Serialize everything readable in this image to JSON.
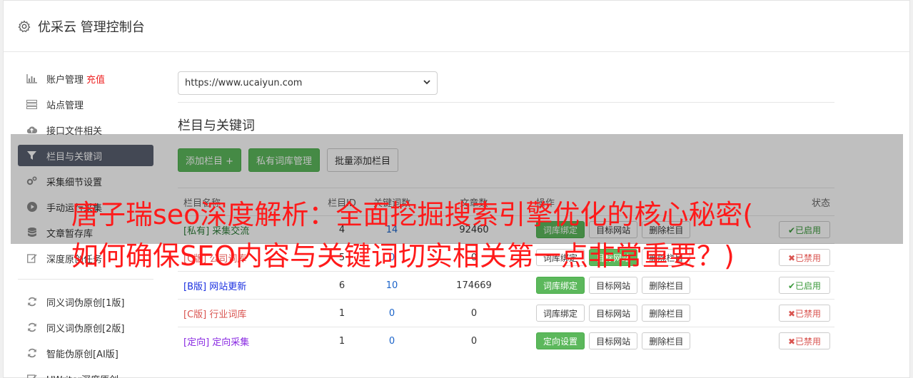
{
  "header": {
    "title": "优采云 管理控制台"
  },
  "sidebar": {
    "items": [
      {
        "label": "账户管理",
        "extra": "充值",
        "icon": "bar-chart-icon"
      },
      {
        "label": "站点管理",
        "icon": "server-icon"
      },
      {
        "label": "接口文件相关",
        "icon": "cloud-upload-icon"
      },
      {
        "label": "栏目与关键词",
        "icon": "filter-icon",
        "active": true
      },
      {
        "label": "采集细节设置",
        "icon": "cogs-icon"
      },
      {
        "label": "手动运行采集",
        "icon": "play-circle-icon"
      },
      {
        "label": "文章暂存库",
        "icon": "database-icon"
      },
      {
        "label": "深度原创任务",
        "icon": "edit-icon"
      }
    ],
    "items2": [
      {
        "label": "同义词伪原创[1版]",
        "icon": "refresh-icon"
      },
      {
        "label": "同义词伪原创[2版]",
        "icon": "refresh-icon"
      },
      {
        "label": "智能伪原创[AI版]",
        "icon": "refresh-icon"
      },
      {
        "label": "UWriter深度原创",
        "icon": "edit-icon"
      }
    ]
  },
  "main": {
    "site_select": "https://www.ucaiyun.com",
    "section_title": "栏目与关键词",
    "buttons": {
      "add": "添加栏目 +",
      "private": "私有词库管理",
      "batch": "批量添加栏目"
    },
    "table": {
      "headers": [
        "栏目名称",
        "栏目ID",
        "关键词数",
        "文章数",
        "操作",
        "状态"
      ],
      "rows": [
        {
          "tag": "[私有]",
          "name": "采集交流",
          "id": "4",
          "words": "14",
          "count": "92460",
          "op1": "词库绑定",
          "op2": "目标网站",
          "op3": "删除栏目",
          "status": "✔已启用",
          "on": true
        },
        {
          "tag": "[C版]",
          "name": "公司词库",
          "id": "5",
          "words": "0",
          "count": "0",
          "op1": "词库绑定",
          "op2": "目标网站",
          "op3": "删除栏目",
          "status": "✖已禁用",
          "on": false
        },
        {
          "tag": "[B版]",
          "name": "网站更新",
          "id": "6",
          "words": "10",
          "count": "174669",
          "op1": "词库绑定",
          "op2": "目标网站",
          "op3": "删除栏目",
          "status": "✔已启用",
          "on": true
        },
        {
          "tag": "[C版]",
          "name": "行业词库",
          "id": "1",
          "words": "0",
          "count": "0",
          "op1": "词库绑定",
          "op2": "目标网站",
          "op3": "删除栏目",
          "status": "✖已禁用",
          "on": false
        },
        {
          "tag": "[定向]",
          "name": "定向采集",
          "id": "1",
          "words": "0",
          "count": "0",
          "op1": "定向设置",
          "op2": "目标网站",
          "op3": "删除栏目",
          "status": "✖已禁用",
          "on": false
        }
      ]
    }
  },
  "overlay": {
    "line1": "唐子瑞seo深度解析：全面挖掘搜索引擎优化的核心秘密(",
    "line2": "如何确保SEO内容与关键词切实相关第一点非常重要？)"
  }
}
